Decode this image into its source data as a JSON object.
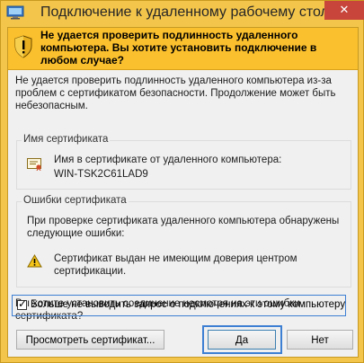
{
  "window": {
    "title": "Подключение к удаленному рабочему столу",
    "close_glyph": "✕",
    "accent_color": "#f3c54b"
  },
  "banner": {
    "text": "Не удается проверить подлинность удаленного компьютера. Вы хотите установить подключение в любом случае?",
    "icon": "security-shield-icon"
  },
  "description": "Не удается проверить подлинность удаленного компьютера из-за проблем с сертификатом безопасности. Продолжение может быть небезопасным.",
  "cert_name_group": {
    "title": "Имя сертификата",
    "label": "Имя в сертификате от удаленного компьютера:",
    "value": "WIN-TSK2C61LAD9",
    "icon": "certificate-icon"
  },
  "cert_errors_group": {
    "title": "Ошибки сертификата",
    "intro": "При проверке сертификата удаленного компьютера обнаружены следующие ошибки:",
    "errors": [
      {
        "icon": "warning-icon",
        "text": "Сертификат выдан не имеющим доверия центром сертификации."
      }
    ]
  },
  "question": "Вы хотите установить соединение несмотря на эти ошибки сертификата?",
  "checkbox": {
    "checked": true,
    "mark": "✓",
    "label": "Больше не выводить запрос о подключениях к этому компьютеру"
  },
  "buttons": {
    "view_cert": "Просмотреть сертификат...",
    "yes": "Да",
    "no": "Нет"
  }
}
